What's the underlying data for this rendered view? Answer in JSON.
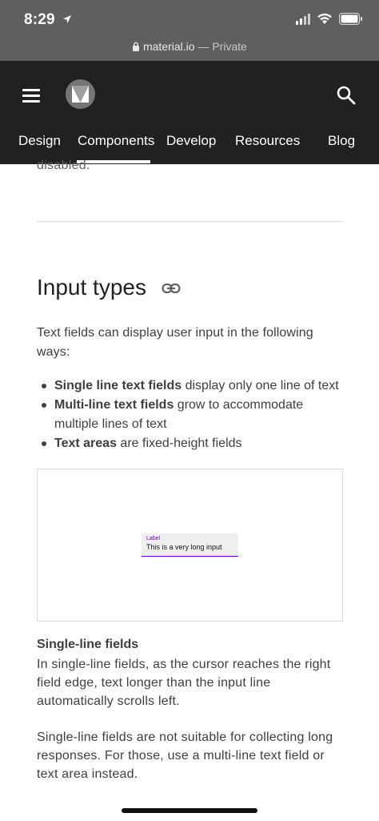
{
  "status_bar": {
    "time": "8:29",
    "url": "material.io",
    "privacy": "— Private"
  },
  "header": {
    "nav_tabs": [
      "Design",
      "Components",
      "Develop",
      "Resources",
      "Blog"
    ],
    "active_tab": "Components"
  },
  "content": {
    "clipped_text": "disabled.",
    "section_title": "Input types",
    "intro": "Text fields can display user input in the following ways:",
    "bullets": [
      {
        "bold": "Single line text fields",
        "rest": " display only one line of text"
      },
      {
        "bold": "Multi-line text fields",
        "rest": " grow to accommodate multiple lines of text"
      },
      {
        "bold": "Text areas",
        "rest": " are fixed-height fields"
      }
    ],
    "demo": {
      "label": "Label",
      "value": "This is a very long input"
    },
    "subsection_title": "Single-line fields",
    "paragraph1": "In single-line fields, as the cursor reaches the right field edge, text longer than the input line automatically scrolls left.",
    "paragraph2": "Single-line fields are not suitable for collecting long responses. For those, use a multi-line text field or text area instead."
  },
  "colors": {
    "header_bg": "#212121",
    "browser_bar_bg": "#5f5f5f",
    "accent": "#6200ee"
  },
  "icons": [
    "location-arrow-icon",
    "signal-icon",
    "wifi-icon",
    "battery-icon",
    "lock-icon",
    "menu-icon",
    "material-logo-icon",
    "search-icon",
    "link-icon"
  ]
}
